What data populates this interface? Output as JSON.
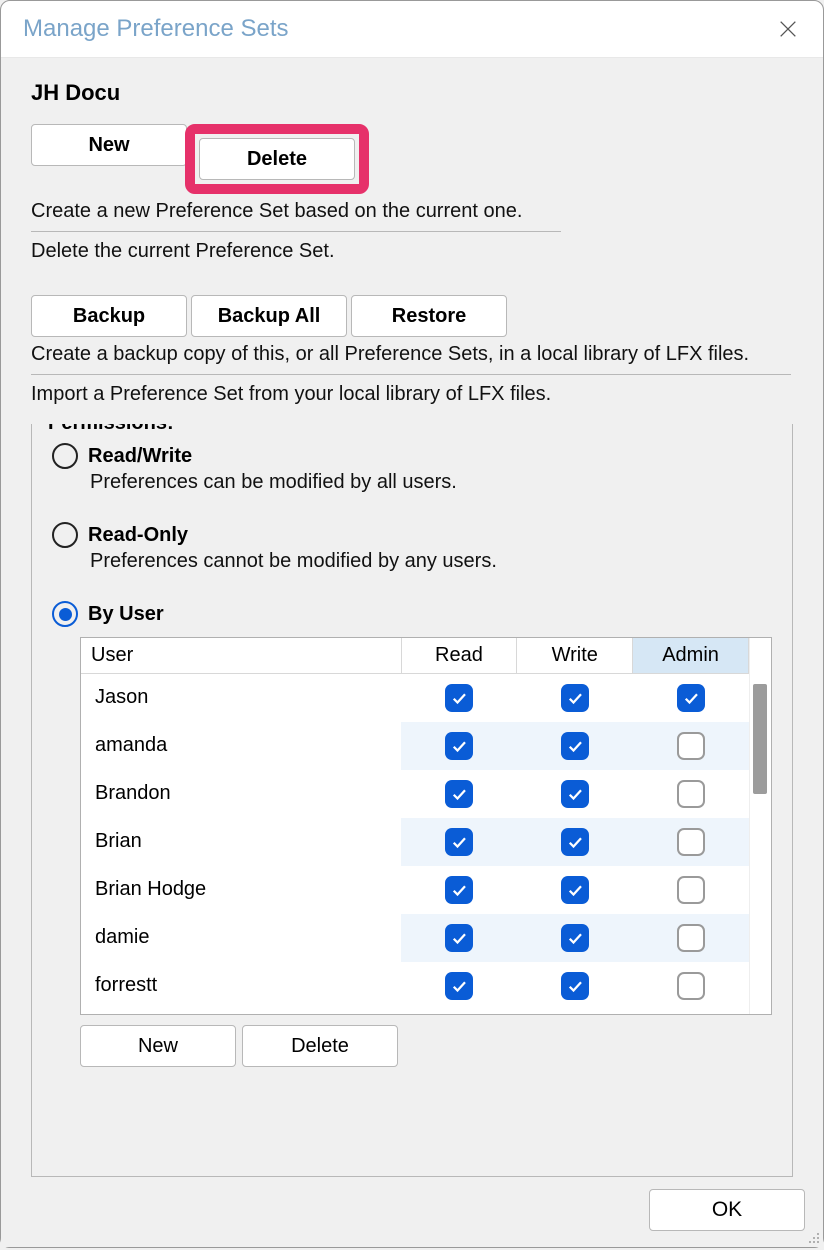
{
  "titlebar": {
    "title": "Manage Preference Sets"
  },
  "set_name": "JH Docu",
  "buttons_row1": {
    "new": "New",
    "delete": "Delete"
  },
  "desc1a": "Create a new Preference Set based on the current one.",
  "desc1b": "Delete the current Preference Set.",
  "buttons_row2": {
    "backup": "Backup",
    "backup_all": "Backup All",
    "restore": "Restore"
  },
  "desc2a": "Create a backup copy of this, or all Preference Sets, in a local library of LFX files.",
  "desc2b": "Import a Preference Set from your local library of LFX files.",
  "permissions": {
    "legend": "Permissions:",
    "options": {
      "readwrite": {
        "label": "Read/Write",
        "desc": "Preferences can be modified by all users."
      },
      "readonly": {
        "label": "Read-Only",
        "desc": "Preferences cannot be modified by any users."
      },
      "byuser": {
        "label": "By User"
      }
    },
    "selected": "byuser",
    "table": {
      "headers": {
        "user": "User",
        "read": "Read",
        "write": "Write",
        "admin": "Admin"
      },
      "rows": [
        {
          "user": "Jason",
          "read": true,
          "write": true,
          "admin": true
        },
        {
          "user": "amanda",
          "read": true,
          "write": true,
          "admin": false
        },
        {
          "user": "Brandon",
          "read": true,
          "write": true,
          "admin": false
        },
        {
          "user": "Brian",
          "read": true,
          "write": true,
          "admin": false
        },
        {
          "user": "Brian Hodge",
          "read": true,
          "write": true,
          "admin": false
        },
        {
          "user": "damie",
          "read": true,
          "write": true,
          "admin": false
        },
        {
          "user": "forrestt",
          "read": true,
          "write": true,
          "admin": false
        }
      ],
      "buttons": {
        "new": "New",
        "delete": "Delete"
      }
    }
  },
  "footer": {
    "ok": "OK"
  }
}
